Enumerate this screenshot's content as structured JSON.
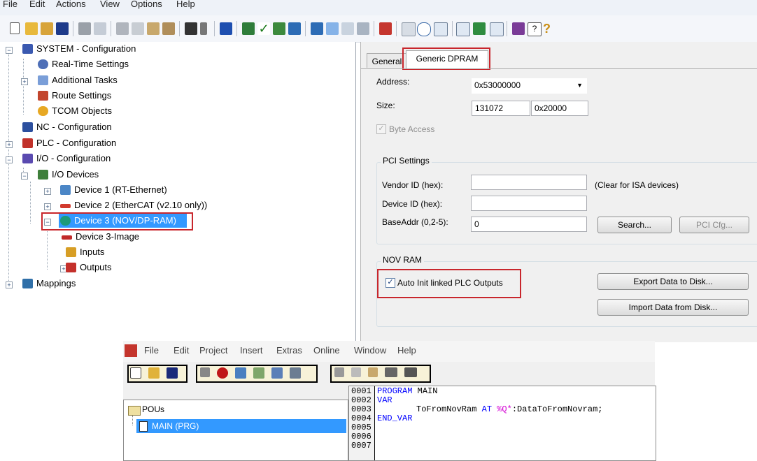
{
  "menubar": {
    "items": [
      "File",
      "Edit",
      "Actions",
      "View",
      "Options",
      "Help"
    ]
  },
  "toolbar": {
    "icons": [
      "new-icon",
      "open-icon",
      "open-project-icon",
      "save-icon",
      "print-icon",
      "print-preview-icon",
      "cut-icon",
      "copy-icon",
      "paste-icon",
      "paste-with-links-icon",
      "find-icon",
      "find-next-icon",
      "target-system-icon",
      "activate-config-icon",
      "check-config-icon",
      "build-icon",
      "restart-icon",
      "run-icon",
      "stop-icon",
      "config-mode-icon",
      "scan-icon",
      "freerun-icon",
      "properties-icon",
      "zoom-icon",
      "watch-icon",
      "online-icon",
      "compare-icon",
      "settings-icon",
      "help-icon",
      "about-icon"
    ]
  },
  "tree": {
    "items": [
      {
        "label": "SYSTEM - Configuration"
      },
      {
        "label": "Real-Time Settings"
      },
      {
        "label": "Additional Tasks"
      },
      {
        "label": "Route Settings"
      },
      {
        "label": "TCOM Objects"
      },
      {
        "label": "NC - Configuration"
      },
      {
        "label": "PLC - Configuration"
      },
      {
        "label": "I/O - Configuration"
      },
      {
        "label": "I/O Devices"
      },
      {
        "label": "Device 1 (RT-Ethernet)"
      },
      {
        "label": "Device 2 (EtherCAT (v2.10 only))"
      },
      {
        "label": "Device 3 (NOV/DP-RAM)"
      },
      {
        "label": "Device 3-Image"
      },
      {
        "label": "Inputs"
      },
      {
        "label": "Outputs"
      },
      {
        "label": "Mappings"
      }
    ]
  },
  "tabs": [
    {
      "label": "General"
    },
    {
      "label": "Generic DPRAM"
    }
  ],
  "form": {
    "address_label": "Address:",
    "address_value": "0x53000000",
    "size_label": "Size:",
    "size_dec": "131072",
    "size_hex": "0x20000",
    "byte_access_label": "Byte Access",
    "pci_group": "PCI Settings",
    "vendor_label": "Vendor ID (hex):",
    "vendor_value": "",
    "clear_hint": "(Clear for ISA devices)",
    "device_label": "Device ID (hex):",
    "device_value": "",
    "baseaddr_label": "BaseAddr (0,2-5):",
    "baseaddr_value": "0",
    "search_button": "Search...",
    "pcicfg_button": "PCI Cfg...",
    "novram_group": "NOV RAM",
    "auto_init_label": "Auto Init linked PLC Outputs",
    "export_button": "Export Data to Disk...",
    "import_button": "Import Data from Disk..."
  },
  "editor": {
    "menu": [
      "File",
      "Edit",
      "Project",
      "Insert",
      "Extras",
      "Online",
      "Window",
      "Help"
    ],
    "toolbar_icons": [
      "new-icon",
      "open-icon",
      "save-icon",
      "print-icon",
      "stop-icon",
      "login-icon",
      "build-icon",
      "run-icon",
      "step-icon",
      "monitor-icon",
      "cut-icon",
      "copy-icon",
      "paste-icon",
      "find-icon",
      "replace-icon"
    ],
    "pous_label": "POUs",
    "main_item": "MAIN (PRG)",
    "line_numbers": [
      "0001",
      "0002",
      "0003",
      "0004",
      "0005",
      "0006",
      "0007"
    ],
    "code": {
      "l1_kw": "PROGRAM",
      "l1_name": " MAIN",
      "l2_kw": "VAR",
      "l3_var": "ToFromNovRam",
      "l3_at": "AT",
      "l3_addr": "%Q*",
      "l3_type": ":DataToFromNovram;",
      "l4_kw": "END_VAR"
    }
  },
  "colors": {
    "selection": "#3399ff",
    "highlight_box": "#c8262c",
    "keyword": "#0000ff",
    "address": "#d400d4"
  }
}
